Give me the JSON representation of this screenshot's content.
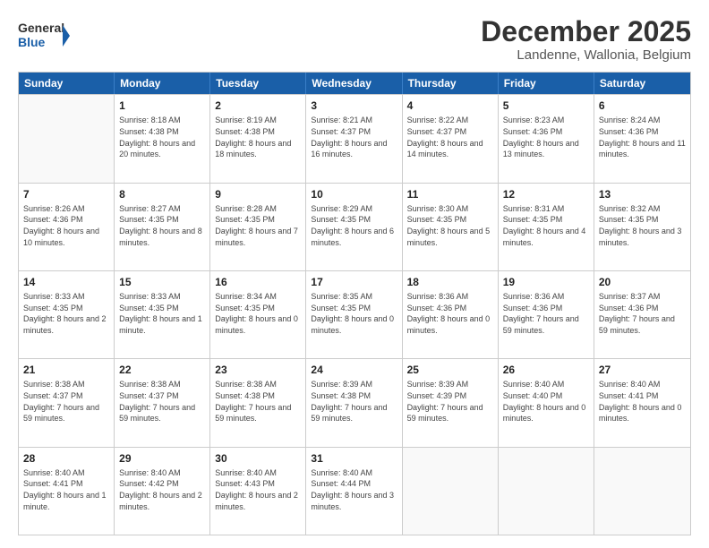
{
  "logo": {
    "line1": "General",
    "line2": "Blue"
  },
  "title": "December 2025",
  "subtitle": "Landenne, Wallonia, Belgium",
  "days": [
    "Sunday",
    "Monday",
    "Tuesday",
    "Wednesday",
    "Thursday",
    "Friday",
    "Saturday"
  ],
  "weeks": [
    [
      {
        "num": "",
        "sunrise": "",
        "sunset": "",
        "daylight": ""
      },
      {
        "num": "1",
        "sunrise": "Sunrise: 8:18 AM",
        "sunset": "Sunset: 4:38 PM",
        "daylight": "Daylight: 8 hours and 20 minutes."
      },
      {
        "num": "2",
        "sunrise": "Sunrise: 8:19 AM",
        "sunset": "Sunset: 4:38 PM",
        "daylight": "Daylight: 8 hours and 18 minutes."
      },
      {
        "num": "3",
        "sunrise": "Sunrise: 8:21 AM",
        "sunset": "Sunset: 4:37 PM",
        "daylight": "Daylight: 8 hours and 16 minutes."
      },
      {
        "num": "4",
        "sunrise": "Sunrise: 8:22 AM",
        "sunset": "Sunset: 4:37 PM",
        "daylight": "Daylight: 8 hours and 14 minutes."
      },
      {
        "num": "5",
        "sunrise": "Sunrise: 8:23 AM",
        "sunset": "Sunset: 4:36 PM",
        "daylight": "Daylight: 8 hours and 13 minutes."
      },
      {
        "num": "6",
        "sunrise": "Sunrise: 8:24 AM",
        "sunset": "Sunset: 4:36 PM",
        "daylight": "Daylight: 8 hours and 11 minutes."
      }
    ],
    [
      {
        "num": "7",
        "sunrise": "Sunrise: 8:26 AM",
        "sunset": "Sunset: 4:36 PM",
        "daylight": "Daylight: 8 hours and 10 minutes."
      },
      {
        "num": "8",
        "sunrise": "Sunrise: 8:27 AM",
        "sunset": "Sunset: 4:35 PM",
        "daylight": "Daylight: 8 hours and 8 minutes."
      },
      {
        "num": "9",
        "sunrise": "Sunrise: 8:28 AM",
        "sunset": "Sunset: 4:35 PM",
        "daylight": "Daylight: 8 hours and 7 minutes."
      },
      {
        "num": "10",
        "sunrise": "Sunrise: 8:29 AM",
        "sunset": "Sunset: 4:35 PM",
        "daylight": "Daylight: 8 hours and 6 minutes."
      },
      {
        "num": "11",
        "sunrise": "Sunrise: 8:30 AM",
        "sunset": "Sunset: 4:35 PM",
        "daylight": "Daylight: 8 hours and 5 minutes."
      },
      {
        "num": "12",
        "sunrise": "Sunrise: 8:31 AM",
        "sunset": "Sunset: 4:35 PM",
        "daylight": "Daylight: 8 hours and 4 minutes."
      },
      {
        "num": "13",
        "sunrise": "Sunrise: 8:32 AM",
        "sunset": "Sunset: 4:35 PM",
        "daylight": "Daylight: 8 hours and 3 minutes."
      }
    ],
    [
      {
        "num": "14",
        "sunrise": "Sunrise: 8:33 AM",
        "sunset": "Sunset: 4:35 PM",
        "daylight": "Daylight: 8 hours and 2 minutes."
      },
      {
        "num": "15",
        "sunrise": "Sunrise: 8:33 AM",
        "sunset": "Sunset: 4:35 PM",
        "daylight": "Daylight: 8 hours and 1 minute."
      },
      {
        "num": "16",
        "sunrise": "Sunrise: 8:34 AM",
        "sunset": "Sunset: 4:35 PM",
        "daylight": "Daylight: 8 hours and 0 minutes."
      },
      {
        "num": "17",
        "sunrise": "Sunrise: 8:35 AM",
        "sunset": "Sunset: 4:35 PM",
        "daylight": "Daylight: 8 hours and 0 minutes."
      },
      {
        "num": "18",
        "sunrise": "Sunrise: 8:36 AM",
        "sunset": "Sunset: 4:36 PM",
        "daylight": "Daylight: 8 hours and 0 minutes."
      },
      {
        "num": "19",
        "sunrise": "Sunrise: 8:36 AM",
        "sunset": "Sunset: 4:36 PM",
        "daylight": "Daylight: 7 hours and 59 minutes."
      },
      {
        "num": "20",
        "sunrise": "Sunrise: 8:37 AM",
        "sunset": "Sunset: 4:36 PM",
        "daylight": "Daylight: 7 hours and 59 minutes."
      }
    ],
    [
      {
        "num": "21",
        "sunrise": "Sunrise: 8:38 AM",
        "sunset": "Sunset: 4:37 PM",
        "daylight": "Daylight: 7 hours and 59 minutes."
      },
      {
        "num": "22",
        "sunrise": "Sunrise: 8:38 AM",
        "sunset": "Sunset: 4:37 PM",
        "daylight": "Daylight: 7 hours and 59 minutes."
      },
      {
        "num": "23",
        "sunrise": "Sunrise: 8:38 AM",
        "sunset": "Sunset: 4:38 PM",
        "daylight": "Daylight: 7 hours and 59 minutes."
      },
      {
        "num": "24",
        "sunrise": "Sunrise: 8:39 AM",
        "sunset": "Sunset: 4:38 PM",
        "daylight": "Daylight: 7 hours and 59 minutes."
      },
      {
        "num": "25",
        "sunrise": "Sunrise: 8:39 AM",
        "sunset": "Sunset: 4:39 PM",
        "daylight": "Daylight: 7 hours and 59 minutes."
      },
      {
        "num": "26",
        "sunrise": "Sunrise: 8:40 AM",
        "sunset": "Sunset: 4:40 PM",
        "daylight": "Daylight: 8 hours and 0 minutes."
      },
      {
        "num": "27",
        "sunrise": "Sunrise: 8:40 AM",
        "sunset": "Sunset: 4:41 PM",
        "daylight": "Daylight: 8 hours and 0 minutes."
      }
    ],
    [
      {
        "num": "28",
        "sunrise": "Sunrise: 8:40 AM",
        "sunset": "Sunset: 4:41 PM",
        "daylight": "Daylight: 8 hours and 1 minute."
      },
      {
        "num": "29",
        "sunrise": "Sunrise: 8:40 AM",
        "sunset": "Sunset: 4:42 PM",
        "daylight": "Daylight: 8 hours and 2 minutes."
      },
      {
        "num": "30",
        "sunrise": "Sunrise: 8:40 AM",
        "sunset": "Sunset: 4:43 PM",
        "daylight": "Daylight: 8 hours and 2 minutes."
      },
      {
        "num": "31",
        "sunrise": "Sunrise: 8:40 AM",
        "sunset": "Sunset: 4:44 PM",
        "daylight": "Daylight: 8 hours and 3 minutes."
      },
      {
        "num": "",
        "sunrise": "",
        "sunset": "",
        "daylight": ""
      },
      {
        "num": "",
        "sunrise": "",
        "sunset": "",
        "daylight": ""
      },
      {
        "num": "",
        "sunrise": "",
        "sunset": "",
        "daylight": ""
      }
    ]
  ]
}
